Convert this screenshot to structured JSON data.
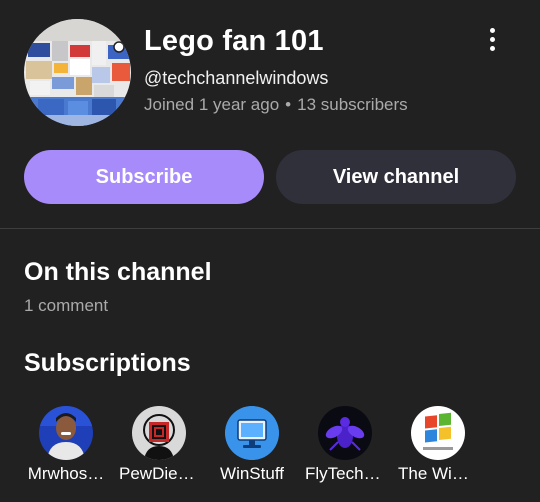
{
  "channel": {
    "title": "Lego fan 101",
    "handle": "@techchannelwindows",
    "joined": "Joined 1 year ago",
    "separator": "•",
    "subscribers": "13 subscribers"
  },
  "actions": {
    "subscribe_label": "Subscribe",
    "view_channel_label": "View channel"
  },
  "on_this_channel": {
    "heading": "On this channel",
    "comments": "1 comment"
  },
  "subscriptions": {
    "heading": "Subscriptions",
    "items": [
      {
        "name": "Mrwhos…"
      },
      {
        "name": "PewDieP…"
      },
      {
        "name": "WinStuff"
      },
      {
        "name": "FlyTech …"
      },
      {
        "name": "The Win…"
      }
    ]
  },
  "colors": {
    "background": "#212121",
    "subscribe_button": "#a78bfa",
    "view_channel_button": "#30303b",
    "secondary_text": "#aaaaaa"
  },
  "icons": {
    "menu": "more-vertical-icon"
  }
}
